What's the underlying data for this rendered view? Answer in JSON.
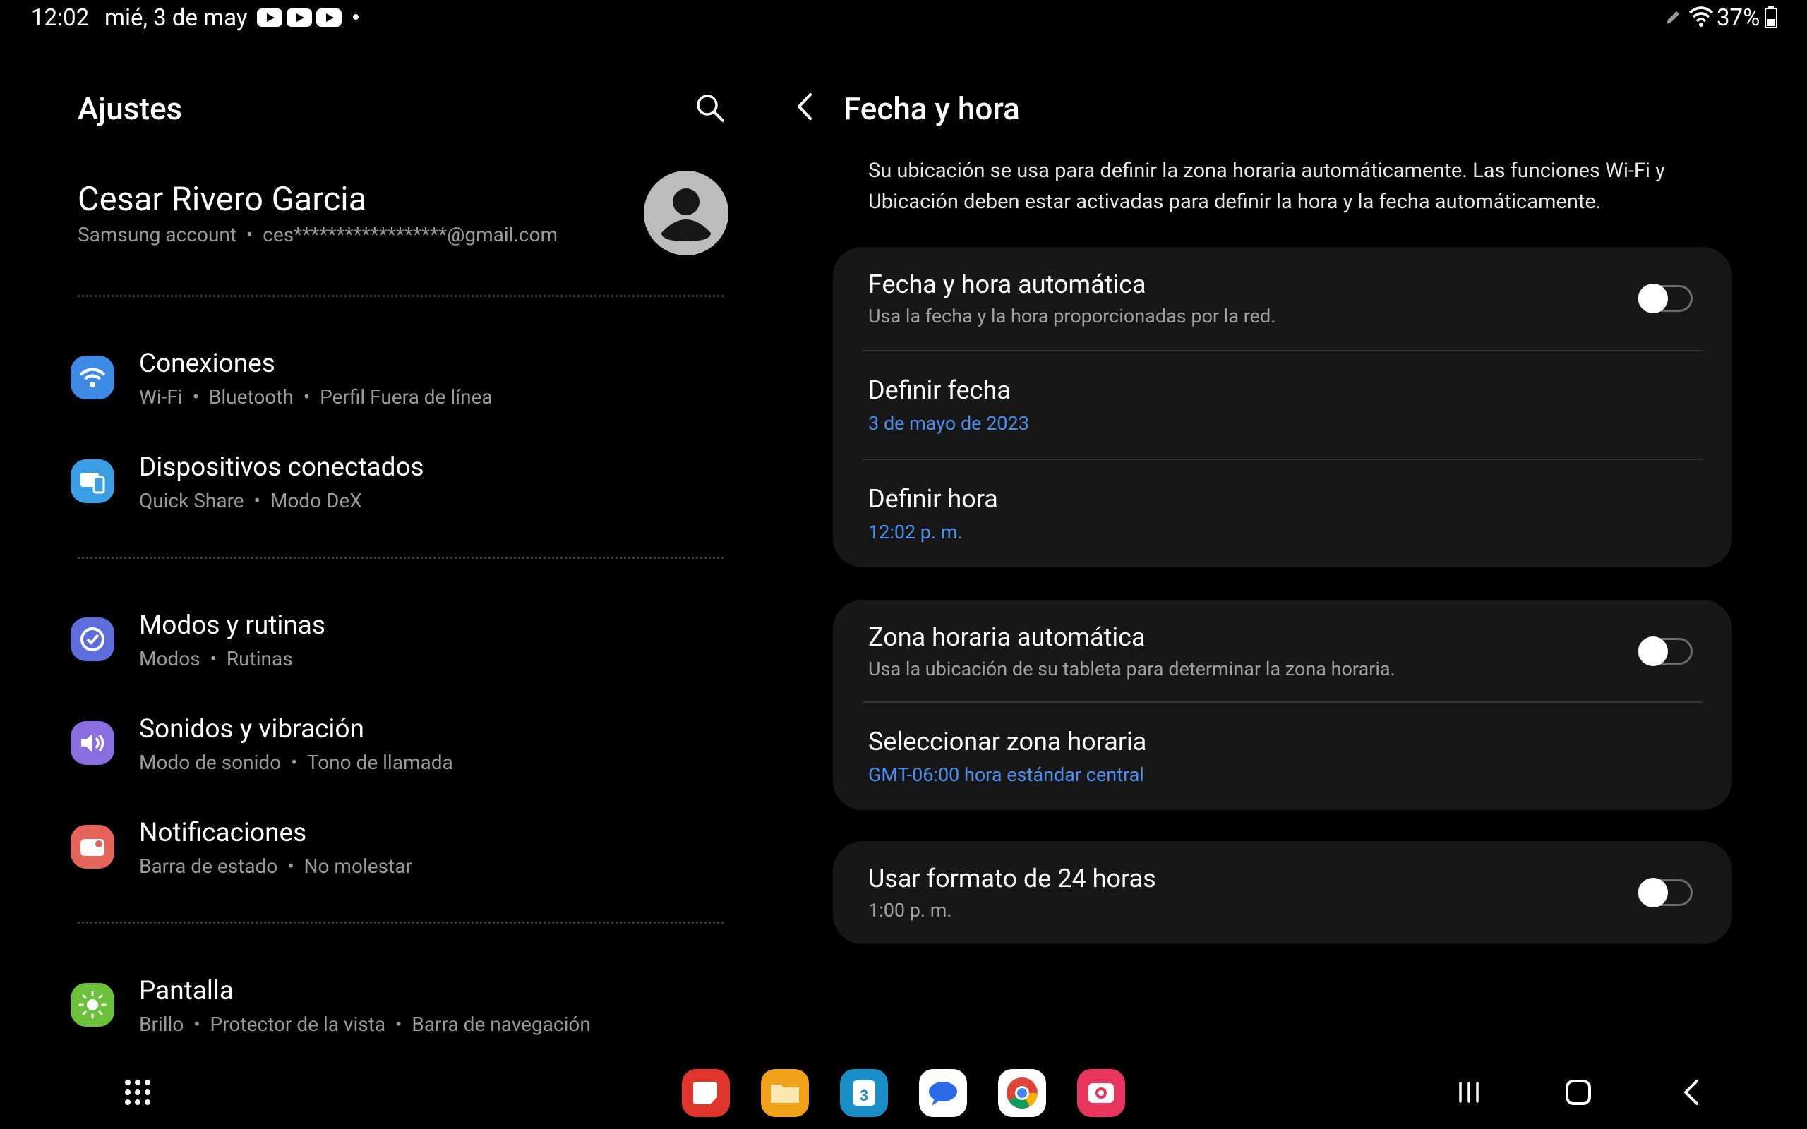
{
  "status_bar": {
    "time": "12:02",
    "date": "mié, 3 de may",
    "battery": "37%"
  },
  "left_pane": {
    "title": "Ajustes",
    "profile": {
      "name": "Cesar Rivero Garcia",
      "subtitle": "Samsung account  •  ces******************@gmail.com"
    },
    "items": [
      {
        "title": "Conexiones",
        "subtitle": "Wi-Fi  •  Bluetooth  •  Perfil Fuera de línea",
        "icon": "wifi-icon",
        "color": "#3e8be6"
      },
      {
        "title": "Dispositivos conectados",
        "subtitle": "Quick Share  •  Modo DeX",
        "icon": "devices-icon",
        "color": "#3a9ee4"
      },
      {
        "title": "Modos y rutinas",
        "subtitle": "Modos  •  Rutinas",
        "icon": "routines-icon",
        "color": "#5d6ddb"
      },
      {
        "title": "Sonidos y vibración",
        "subtitle": "Modo de sonido  •  Tono de llamada",
        "icon": "sound-icon",
        "color": "#8a6ee0"
      },
      {
        "title": "Notificaciones",
        "subtitle": "Barra de estado  •  No molestar",
        "icon": "notifications-icon",
        "color": "#e4645a"
      },
      {
        "title": "Pantalla",
        "subtitle": "Brillo  •  Protector de la vista  •  Barra de navegación",
        "icon": "display-icon",
        "color": "#6cc03a"
      }
    ]
  },
  "right_pane": {
    "title": "Fecha y hora",
    "info": "Su ubicación se usa para definir la zona horaria automáticamente. Las funciones Wi-Fi y Ubicación deben estar activadas para definir la hora y la fecha automáticamente.",
    "card1": {
      "auto_datetime": {
        "title": "Fecha y hora automática",
        "subtitle": "Usa la fecha y la hora proporcionadas por la red.",
        "enabled": false
      },
      "set_date": {
        "title": "Definir fecha",
        "value": "3 de mayo de 2023"
      },
      "set_time": {
        "title": "Definir hora",
        "value": "12:02 p. m."
      }
    },
    "card2": {
      "auto_timezone": {
        "title": "Zona horaria automática",
        "subtitle": "Usa la ubicación de su tableta para determinar la zona horaria.",
        "enabled": false
      },
      "select_timezone": {
        "title": "Seleccionar zona horaria",
        "value": "GMT-06:00 hora estándar central"
      }
    },
    "card3": {
      "format24": {
        "title": "Usar formato de 24 horas",
        "subtitle": "1:00 p. m.",
        "enabled": false
      }
    }
  },
  "dock": {
    "apps": [
      {
        "icon": "notes-app-icon",
        "color": "#e0352b"
      },
      {
        "icon": "files-app-icon",
        "color": "#f0a21a"
      },
      {
        "icon": "calendar-app-icon",
        "color": "#1a8fc7",
        "label": "3"
      },
      {
        "icon": "messages-app-icon",
        "color": "#ffffff"
      },
      {
        "icon": "chrome-app-icon",
        "color": "#ffffff"
      },
      {
        "icon": "camera-app-icon",
        "color": "#e8365e"
      }
    ]
  },
  "colors": {
    "accent_blue": "#4f8ff0",
    "card_bg": "#171717"
  }
}
